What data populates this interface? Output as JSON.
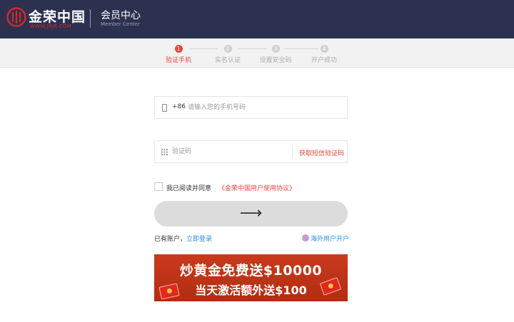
{
  "header": {
    "logo_text": "金荣中国",
    "logo_url": "WWW.JRJR.COM",
    "member_title": "会员中心",
    "member_subtitle": "Member Center",
    "bg_color": "#2c3150"
  },
  "steps": [
    {
      "num": "1",
      "label": "验证手机",
      "active": true
    },
    {
      "num": "2",
      "label": "实名认证",
      "active": false
    },
    {
      "num": "3",
      "label": "设置安全码",
      "active": false
    },
    {
      "num": "4",
      "label": "开户成功",
      "active": false
    }
  ],
  "form": {
    "country_code": "+86",
    "phone_placeholder": "请输入您的手机号码",
    "code_placeholder": "验证码",
    "get_code_label": "获取短信验证码",
    "agree_text": "我已阅读并同意",
    "agree_link": "《金荣中国用户使用协议》",
    "submit_label": "⟶"
  },
  "links": {
    "has_account": "已有账户，",
    "login": "立即登录",
    "overseas": "海外用户开户"
  },
  "banner": {
    "line1": "炒黄金免费送$10000",
    "line2": "当天激活额外送$100"
  },
  "colors": {
    "accent": "#e8453c",
    "link": "#2e8ce6"
  }
}
